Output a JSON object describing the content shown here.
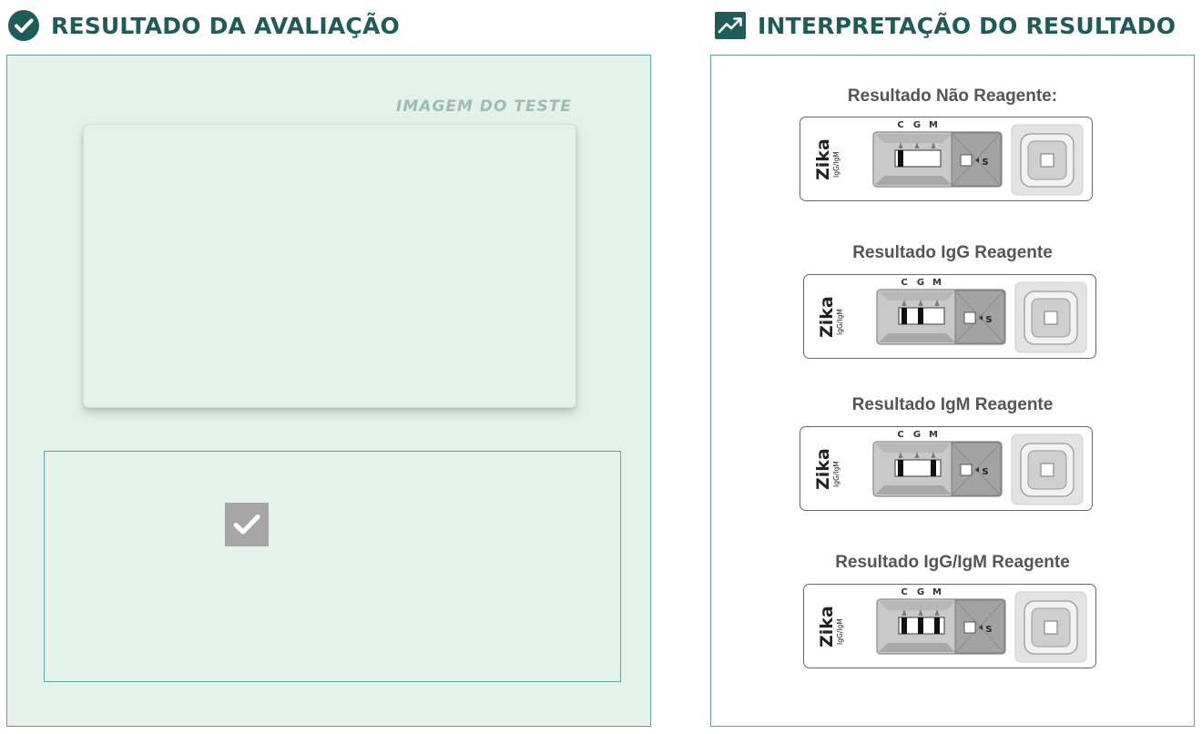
{
  "left": {
    "title": "RESULTADO DA AVALIAÇÃO",
    "title_icon": "check-circle-icon",
    "image_label": "IMAGEM DO TESTE",
    "checkbox_icon": "checkmark-icon",
    "checkbox_checked": true
  },
  "right": {
    "title": "INTERPRETAÇÃO DO RESULTADO",
    "title_icon": "trending-up-icon",
    "results": [
      {
        "title": "Resultado Não Reagente:",
        "brand": "Zika",
        "sub": "IgG/IgM",
        "letters": [
          "C",
          "G",
          "M"
        ],
        "sample_label": "S",
        "bands": [
          "C"
        ]
      },
      {
        "title": "Resultado IgG Reagente",
        "brand": "Zika",
        "sub": "IgG/IgM",
        "letters": [
          "C",
          "G",
          "M"
        ],
        "sample_label": "S",
        "bands": [
          "C",
          "G"
        ]
      },
      {
        "title": "Resultado IgM Reagente",
        "brand": "Zika",
        "sub": "IgG/IgM",
        "letters": [
          "C",
          "G",
          "M"
        ],
        "sample_label": "S",
        "bands": [
          "C",
          "M"
        ]
      },
      {
        "title": "Resultado IgG/IgM Reagente",
        "brand": "Zika",
        "sub": "IgG/IgM",
        "letters": [
          "C",
          "G",
          "M"
        ],
        "sample_label": "S",
        "bands": [
          "C",
          "G",
          "M"
        ]
      }
    ]
  },
  "colors": {
    "title": "#1f5b58",
    "panel_bg": "#e5f2ec",
    "panel_border": "#5fa3a6",
    "image_label": "#9cbdb5",
    "checkbox": "#a6a6a6",
    "result_title": "#555555"
  }
}
